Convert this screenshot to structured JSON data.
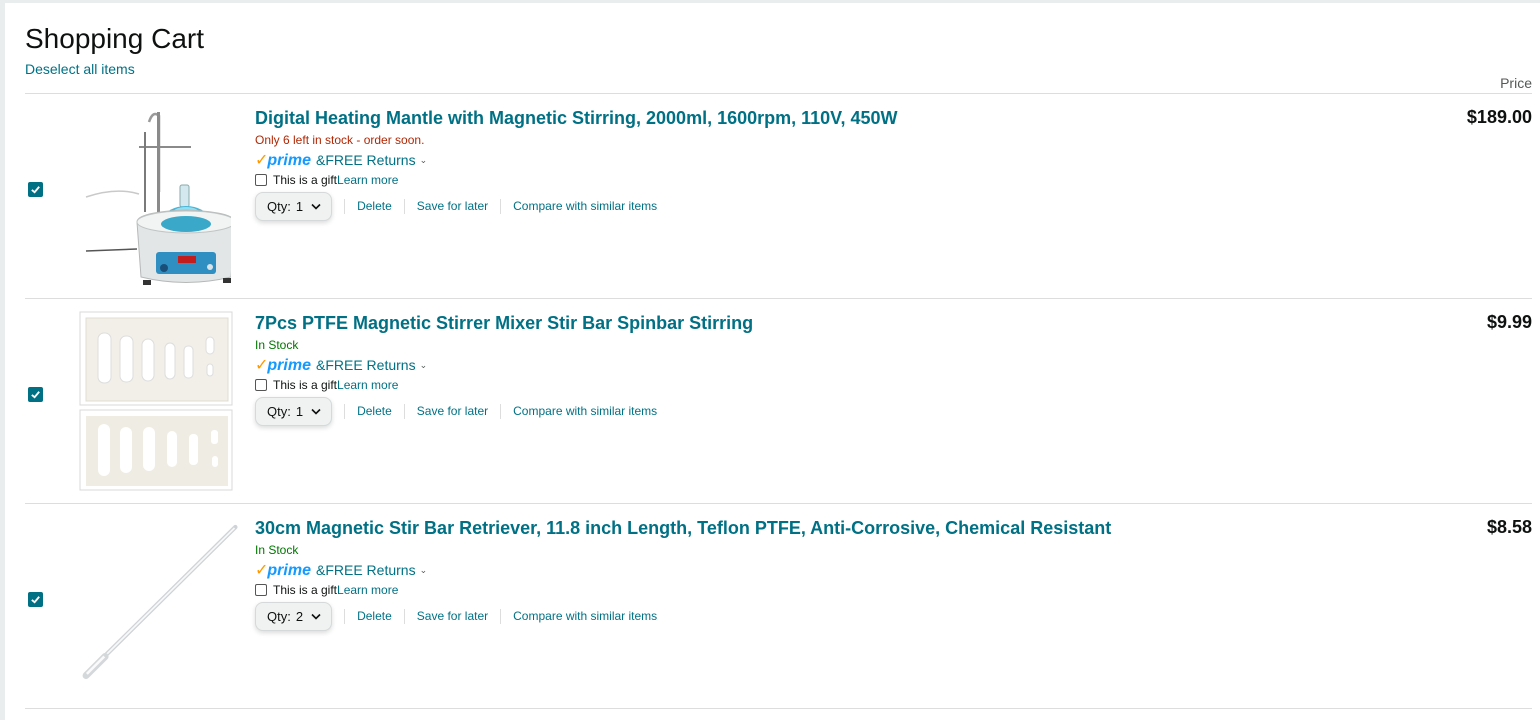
{
  "cart": {
    "title": "Shopping Cart",
    "deselect_label": "Deselect all items",
    "price_header": "Price"
  },
  "items": [
    {
      "title": "Digital Heating Mantle with Magnetic Stirring, 2000ml, 1600rpm, 110V, 450W",
      "stock": "Only 6 left in stock - order soon.",
      "stock_status": "low",
      "prime_check": "✓",
      "prime_word": "prime",
      "free_returns": "&FREE Returns",
      "gift_label": "This is a gift",
      "learn_more": "Learn more",
      "qty_label": "Qty:",
      "qty": "1",
      "delete": "Delete",
      "save_for_later": "Save for later",
      "compare": "Compare with similar items",
      "price": "$189.00",
      "selected": true,
      "image_icon": "heating-mantle-image"
    },
    {
      "title": "7Pcs PTFE Magnetic Stirrer Mixer Stir Bar Spinbar Stirring",
      "stock": "In Stock",
      "stock_status": "ok",
      "prime_check": "✓",
      "prime_word": "prime",
      "free_returns": "&FREE Returns",
      "gift_label": "This is a gift",
      "learn_more": "Learn more",
      "qty_label": "Qty:",
      "qty": "1",
      "delete": "Delete",
      "save_for_later": "Save for later",
      "compare": "Compare with similar items",
      "price": "$9.99",
      "selected": true,
      "image_icon": "stir-bar-set-image"
    },
    {
      "title": "30cm Magnetic Stir Bar Retriever, 11.8 inch Length, Teflon PTFE, Anti-Corrosive, Chemical Resistant",
      "stock": "In Stock",
      "stock_status": "ok",
      "prime_check": "✓",
      "prime_word": "prime",
      "free_returns": "&FREE Returns",
      "gift_label": "This is a gift",
      "learn_more": "Learn more",
      "qty_label": "Qty:",
      "qty": "2",
      "delete": "Delete",
      "save_for_later": "Save for later",
      "compare": "Compare with similar items",
      "price": "$8.58",
      "selected": true,
      "image_icon": "stir-bar-retriever-image"
    }
  ],
  "colors": {
    "link": "#007185",
    "stock_low": "#b12704",
    "stock_ok": "#007600",
    "prime_check": "#ff9900",
    "prime_word": "#1399ff",
    "checkbox": "#007185"
  }
}
